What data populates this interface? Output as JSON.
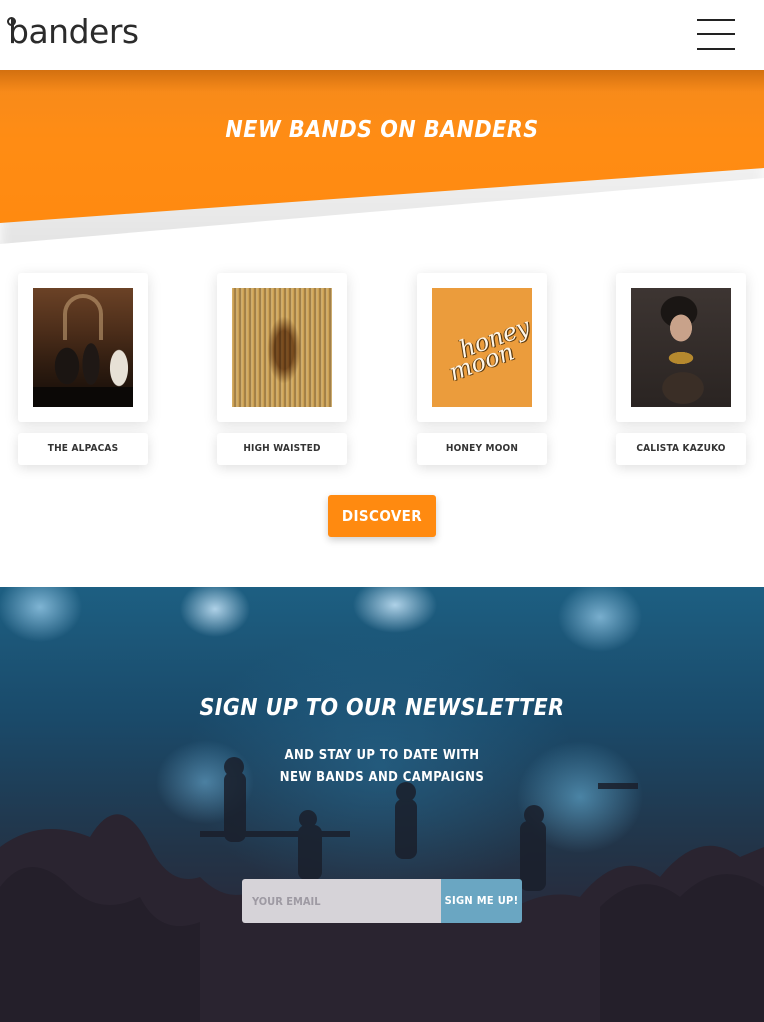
{
  "header": {
    "logo_text": "banders",
    "menu_icon": "hamburger-menu-icon"
  },
  "hero": {
    "title": "NEW BANDS ON BANDERS"
  },
  "bands": [
    {
      "name": "THE ALPACAS"
    },
    {
      "name": "HIGH WAISTED"
    },
    {
      "name": "HONEY MOON",
      "artwork_text_line1": "honey",
      "artwork_text_line2": "moon"
    },
    {
      "name": "CALISTA KAZUKO"
    }
  ],
  "discover": {
    "label": "DISCOVER"
  },
  "newsletter": {
    "title": "SIGN UP TO OUR NEWSLETTER",
    "subtitle_line1": "AND STAY UP TO DATE WITH",
    "subtitle_line2": "NEW BANDS AND CAMPAIGNS",
    "email_placeholder": "YOUR EMAIL",
    "submit_label": "SIGN ME UP!"
  },
  "colors": {
    "accent_orange": "#ff8a10",
    "signup_button": "#6aa6c2",
    "input_bg": "#d6d3d8"
  }
}
